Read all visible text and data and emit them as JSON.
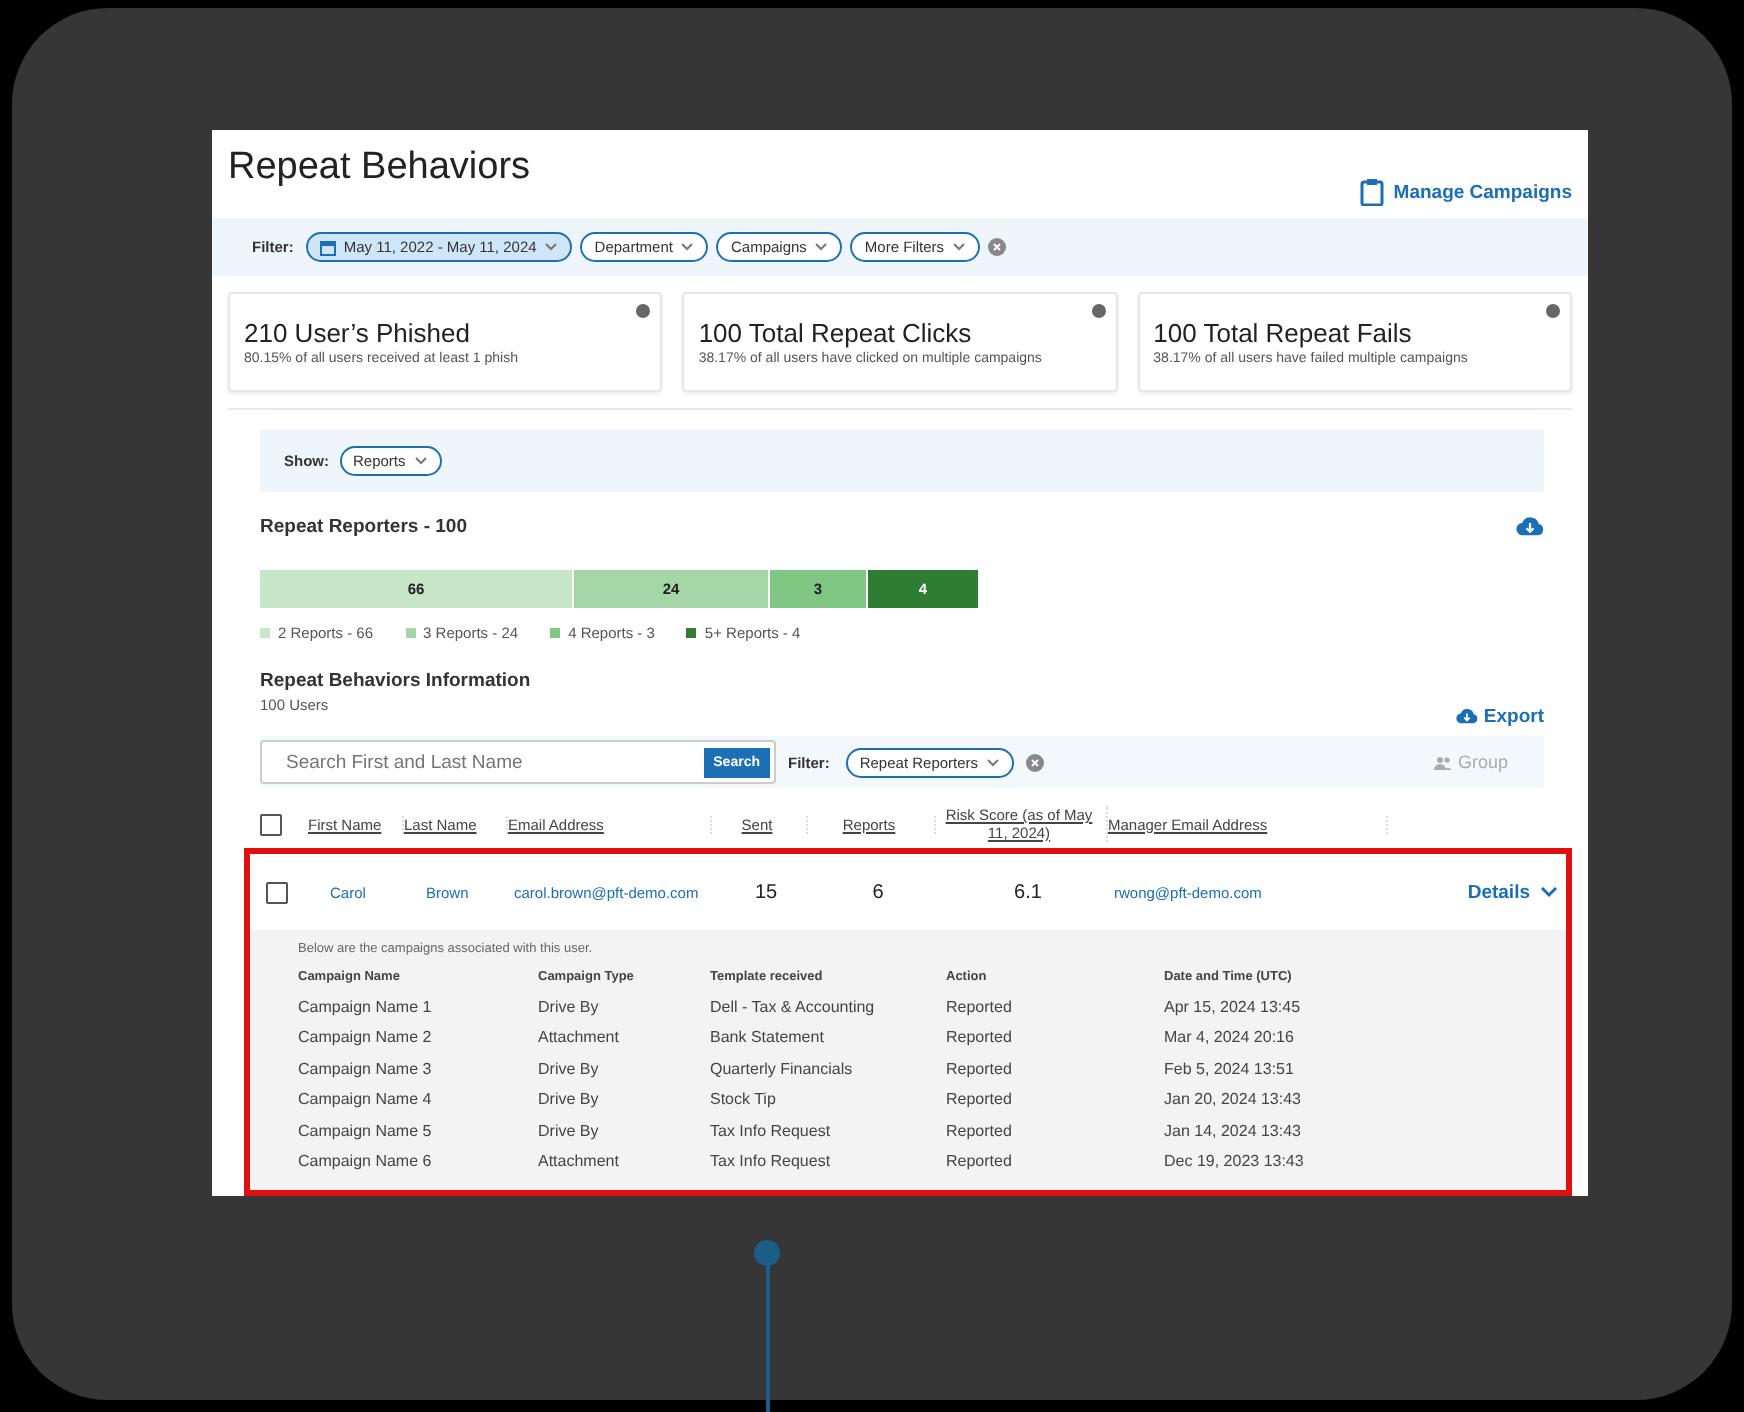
{
  "title": "Repeat Behaviors",
  "manage_link": "Manage Campaigns",
  "filter_bar": {
    "label": "Filter:",
    "chips": [
      {
        "label": "May 11, 2022 - May 11, 2024",
        "kind": "date",
        "selected": true
      },
      {
        "label": "Department",
        "kind": "plain",
        "selected": false
      },
      {
        "label": "Campaigns",
        "kind": "plain",
        "selected": false
      },
      {
        "label": "More Filters",
        "kind": "plain",
        "selected": false
      }
    ]
  },
  "stat_cards": [
    {
      "title": "210 User’s Phished",
      "subtitle": "80.15% of all users received at least 1 phish"
    },
    {
      "title": "100 Total Repeat Clicks",
      "subtitle": "38.17% of all users have clicked on multiple campaigns"
    },
    {
      "title": "100 Total Repeat Fails",
      "subtitle": "38.17% of all users have failed multiple campaigns"
    }
  ],
  "show": {
    "label": "Show:",
    "value": "Reports"
  },
  "reporters": {
    "title": "Repeat Reporters - 100",
    "segments": [
      {
        "label": "66",
        "legend": "2 Reports - 66",
        "color": "#c8e6c9"
      },
      {
        "label": "24",
        "legend": "3 Reports - 24",
        "color": "#a5d6a7"
      },
      {
        "label": "3",
        "legend": "4 Reports - 3",
        "color": "#81c784"
      },
      {
        "label": "4",
        "legend": "5+ Reports - 4",
        "color": "#2e7d32"
      }
    ]
  },
  "info": {
    "title": "Repeat Behaviors Information",
    "count": "100 Users",
    "export": "Export",
    "search": {
      "placeholder": "Search First and Last Name",
      "button": "Search"
    },
    "filter_label": "Filter:",
    "filter_chip": "Repeat Reporters",
    "group": "Group",
    "group_disabled": true
  },
  "table": {
    "select_all_checked": false,
    "columns": [
      "First Name",
      "Last Name",
      "Email Address",
      "Sent",
      "Reports",
      "Risk Score (as of May 11, 2024)",
      "Manager Email Address"
    ],
    "rows": [
      {
        "checked": false,
        "expanded": true,
        "cells": [
          "Carol",
          "Brown",
          "carol.brown@pft-demo.com",
          "15",
          "6",
          "6.1",
          "rwong@pft-demo.com"
        ],
        "details": "Details"
      }
    ]
  },
  "details": {
    "intro": "Below are the campaigns associated with this user.",
    "columns": [
      "Campaign Name",
      "Campaign Type",
      "Template received",
      "Action",
      "Date and Time (UTC)"
    ],
    "rows": [
      [
        "Campaign Name 1",
        "Drive By",
        "Dell - Tax & Accounting",
        "Reported",
        "Apr 15, 2024 13:45"
      ],
      [
        "Campaign Name 2",
        "Attachment",
        "Bank Statement",
        "Reported",
        "Mar 4, 2024 20:16"
      ],
      [
        "Campaign Name 3",
        "Drive By",
        "Quarterly Financials",
        "Reported",
        "Feb 5, 2024 13:51"
      ],
      [
        "Campaign Name 4",
        "Drive By",
        "Stock Tip",
        "Reported",
        "Jan 20, 2024 13:43"
      ],
      [
        "Campaign Name 5",
        "Drive By",
        "Tax Info Request",
        "Reported",
        "Jan 14, 2024 13:43"
      ],
      [
        "Campaign Name 6",
        "Attachment",
        "Tax Info Request",
        "Reported",
        "Dec 19, 2023 13:43"
      ]
    ]
  }
}
